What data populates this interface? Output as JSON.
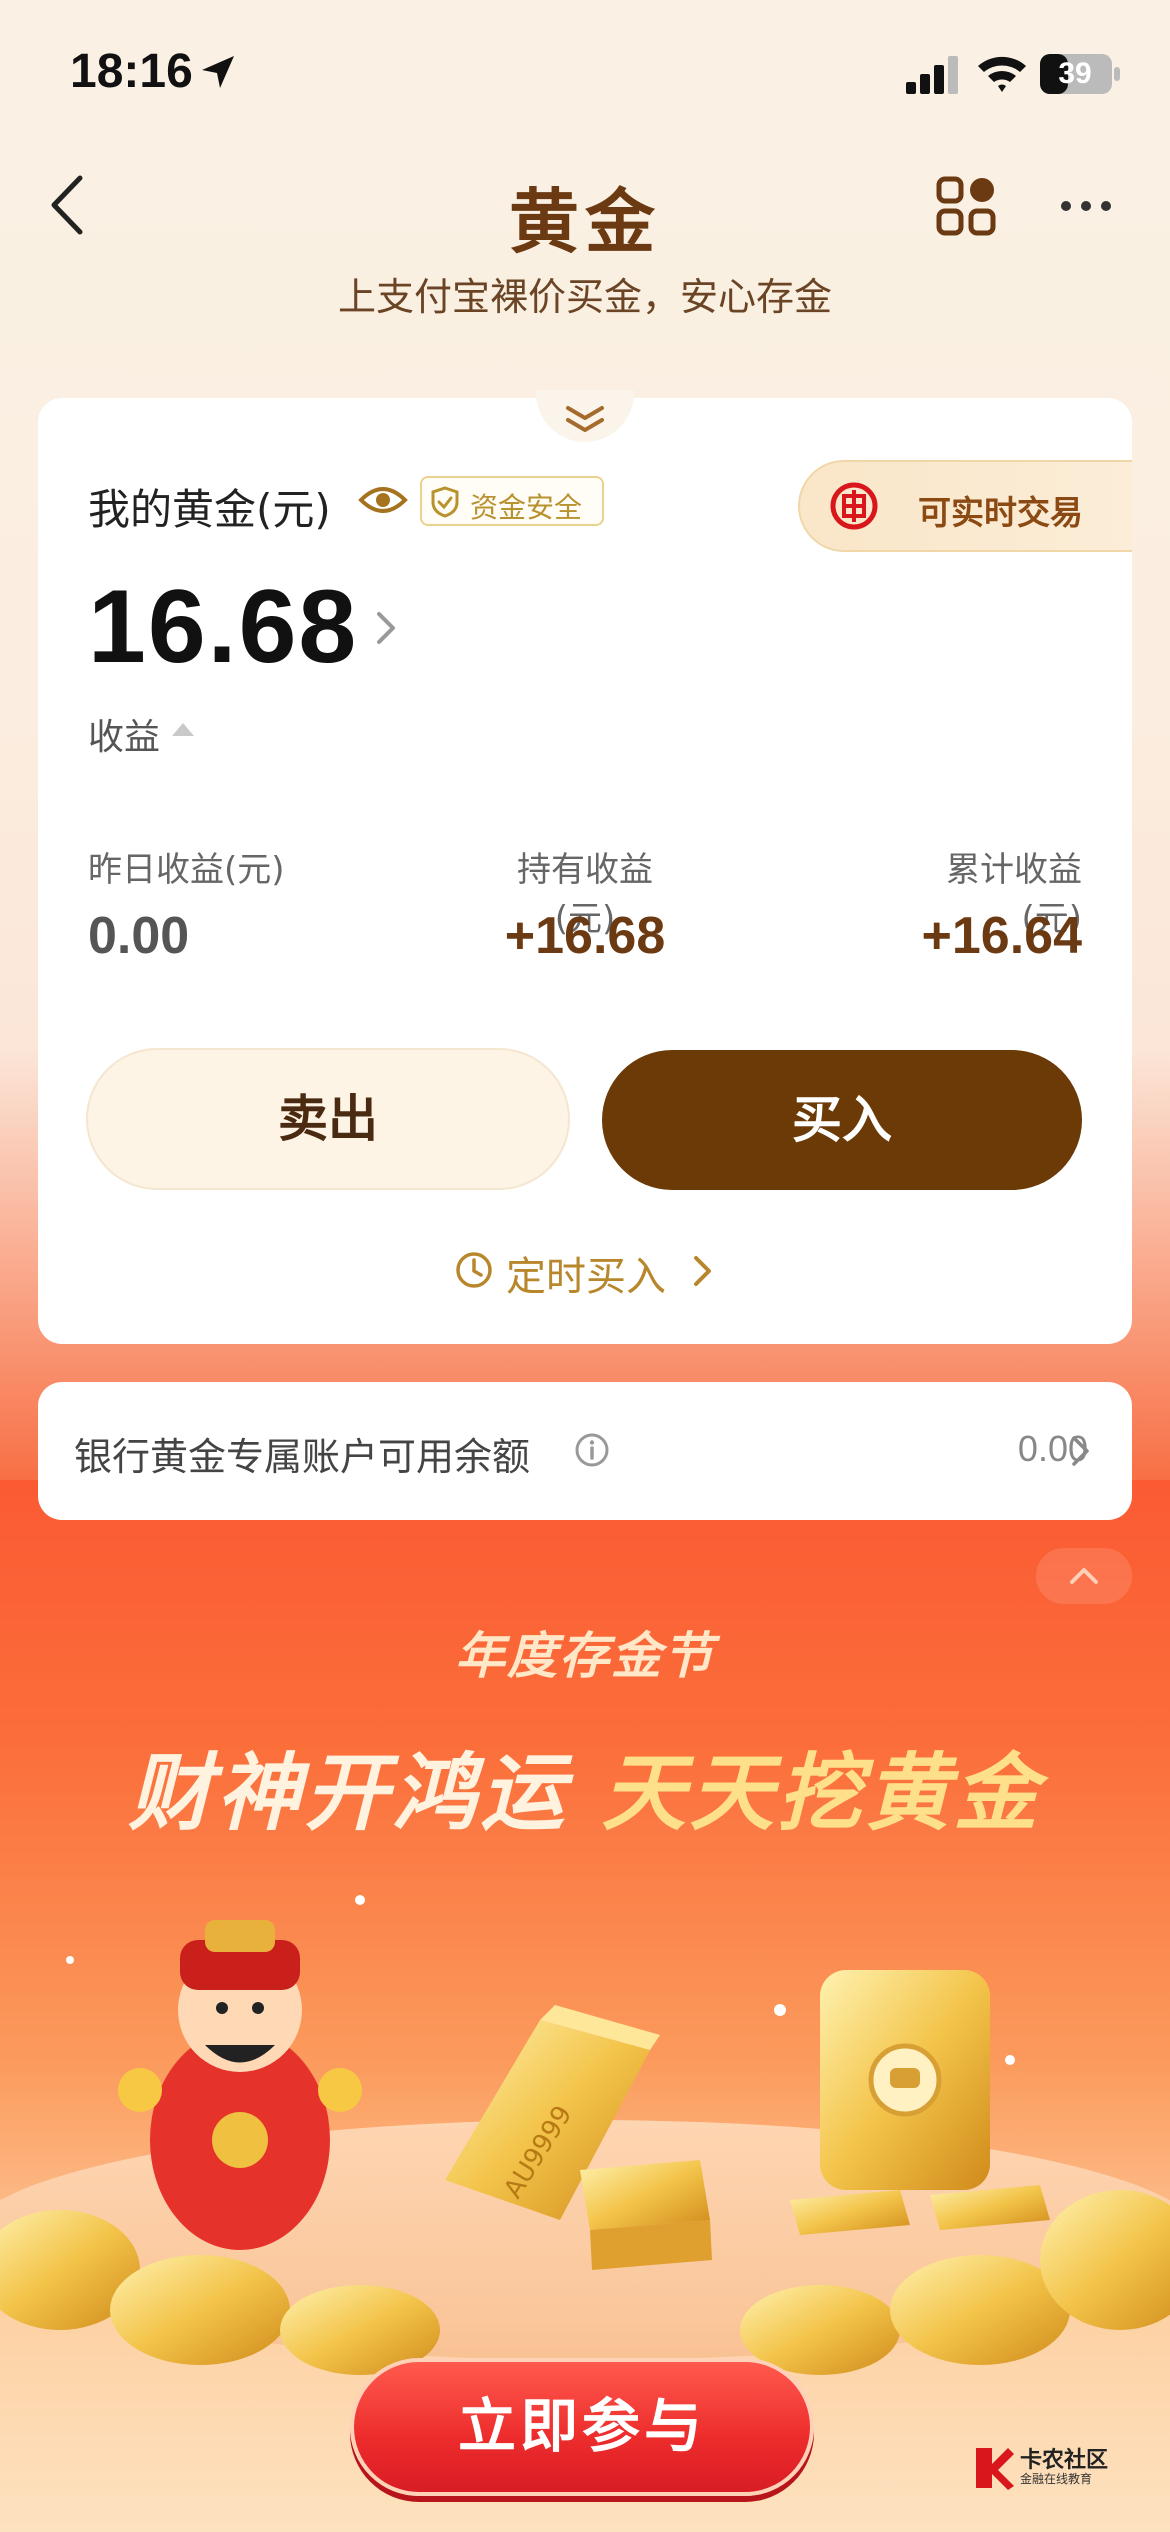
{
  "status_bar": {
    "time": "18:16",
    "battery": "39"
  },
  "header": {
    "title": "黄金",
    "subtitle": "上支付宝裸价买金，安心存金"
  },
  "gold_card": {
    "label": "我的黄金(元)",
    "safe_badge": "资金安全",
    "realtime_badge": "可实时交易",
    "balance": "16.68",
    "profit_label": "收益",
    "stats": [
      {
        "label": "昨日收益(元)",
        "value": "0.00"
      },
      {
        "label": "持有收益(元)",
        "value": "+16.68"
      },
      {
        "label": "累计收益(元)",
        "value": "+16.64"
      }
    ],
    "sell_label": "卖出",
    "buy_label": "买入",
    "timed_buy_label": "定时买入"
  },
  "bank_account": {
    "label": "银行黄金专属账户可用余额",
    "amount": "0.00"
  },
  "banner": {
    "festival": "年度存金节",
    "slogan_part1": "财神开鸿运",
    "slogan_part2": "天天挖黄金",
    "bar_engraving": "AU9999",
    "cta": "立即参与"
  },
  "watermark": {
    "title": "卡农社区",
    "subtitle": "金融在线教育"
  },
  "colors": {
    "brand_brown": "#6b3a07",
    "accent_gold": "#b8872c",
    "cta_red": "#ec2b2b",
    "banner_orange": "#fb5a33"
  }
}
